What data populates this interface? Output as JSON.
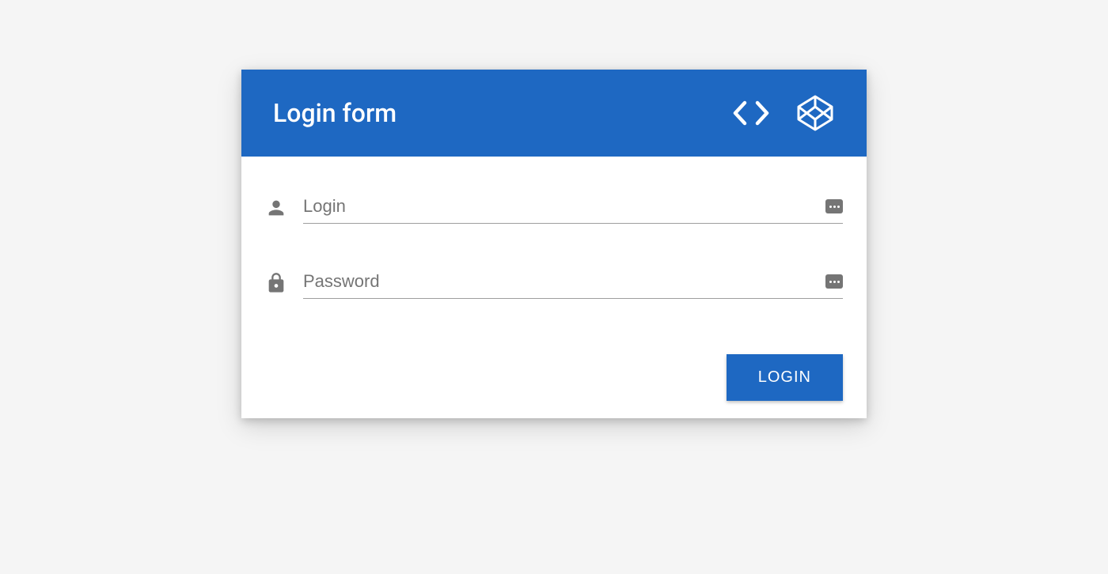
{
  "header": {
    "title": "Login form"
  },
  "fields": {
    "login": {
      "placeholder": "Login",
      "value": ""
    },
    "password": {
      "placeholder": "Password",
      "value": ""
    }
  },
  "actions": {
    "login_button": "LOGIN"
  }
}
